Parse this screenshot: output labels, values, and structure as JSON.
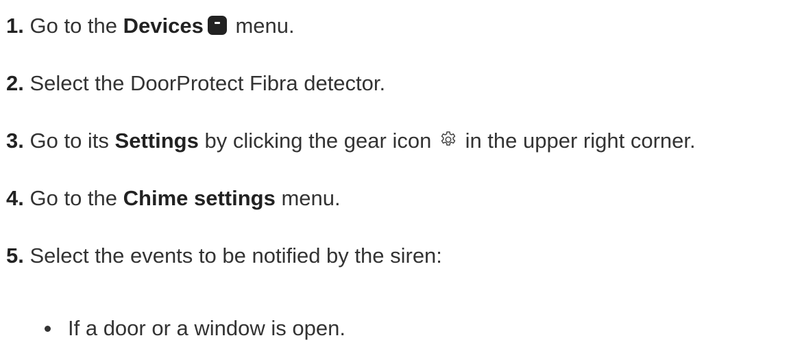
{
  "steps": [
    {
      "number": "1.",
      "pre": "Go to the",
      "bold": "Devices",
      "icon": "devices-icon",
      "post": "menu."
    },
    {
      "number": "2.",
      "text": "Select the DoorProtect Fibra detector."
    },
    {
      "number": "3.",
      "pre": "Go to its",
      "bold": "Settings",
      "mid": "by clicking the gear icon",
      "icon": "gear-icon",
      "post": "in the upper right corner."
    },
    {
      "number": "4.",
      "pre": "Go to the",
      "bold": "Chime settings",
      "post": "menu."
    },
    {
      "number": "5.",
      "text": "Select the events to be notified by the siren:"
    }
  ],
  "bullets": [
    "If a door or a window is open."
  ]
}
